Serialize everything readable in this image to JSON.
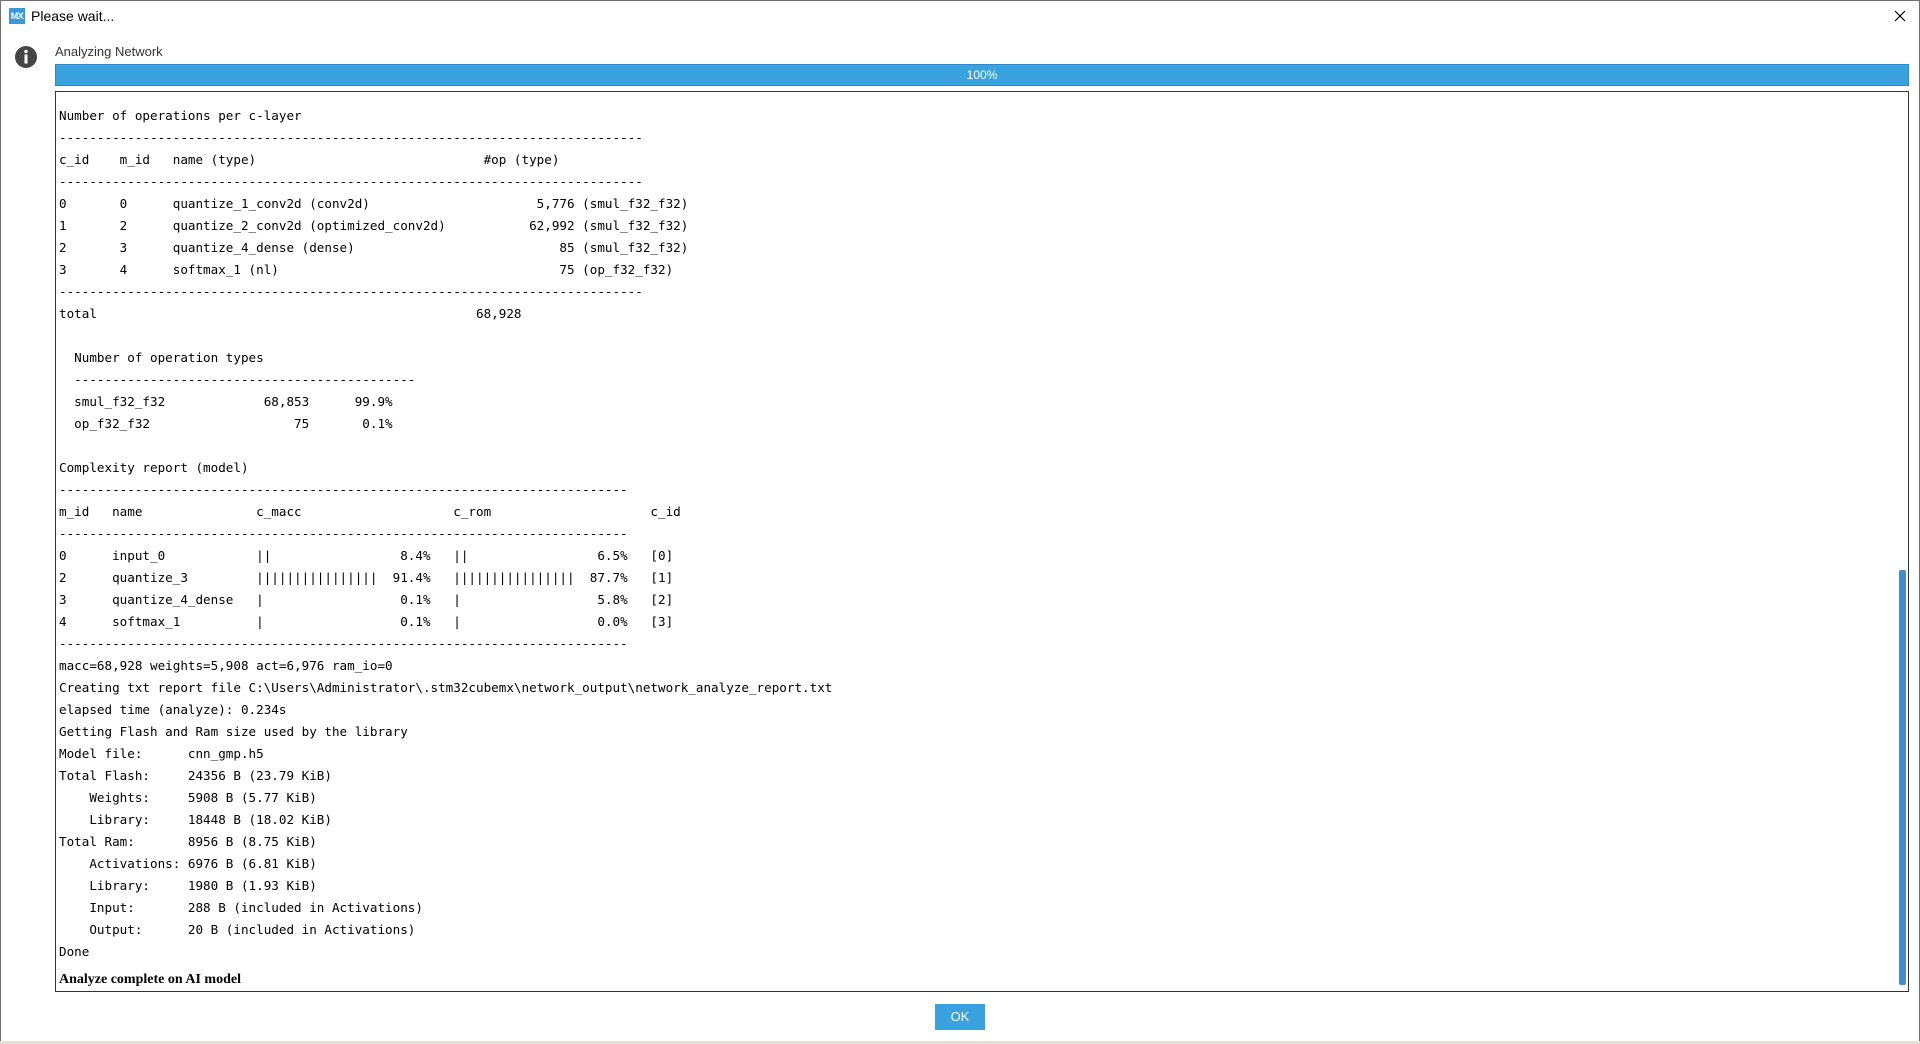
{
  "window": {
    "title": "Please wait...",
    "app_icon_label": "MX",
    "accent_color": "#3aa3df",
    "close_icon": "close-icon"
  },
  "status": {
    "label": "Analyzing Network",
    "info_icon": "info-icon",
    "progress_percent": 100,
    "progress_text": "100%"
  },
  "console": {
    "lines": [
      "Number of operations per c-layer",
      "-----------------------------------------------------------------------------",
      "c_id    m_id   name (type)                              #op (type)",
      "-----------------------------------------------------------------------------",
      "0       0      quantize_1_conv2d (conv2d)                      5,776 (smul_f32_f32)",
      "1       2      quantize_2_conv2d (optimized_conv2d)           62,992 (smul_f32_f32)",
      "2       3      quantize_4_dense (dense)                           85 (smul_f32_f32)",
      "3       4      softmax_1 (nl)                                     75 (op_f32_f32)",
      "-----------------------------------------------------------------------------",
      "total                                                  68,928",
      "",
      "  Number of operation types",
      "  ---------------------------------------------",
      "  smul_f32_f32             68,853      99.9%",
      "  op_f32_f32                   75       0.1%",
      "",
      "Complexity report (model)",
      "---------------------------------------------------------------------------",
      "m_id   name               c_macc                    c_rom                     c_id",
      "---------------------------------------------------------------------------",
      "0      input_0            ||                 8.4%   ||                 6.5%   [0]",
      "2      quantize_3         ||||||||||||||||  91.4%   ||||||||||||||||  87.7%   [1]",
      "3      quantize_4_dense   |                  0.1%   |                  5.8%   [2]",
      "4      softmax_1          |                  0.1%   |                  0.0%   [3]",
      "---------------------------------------------------------------------------",
      "macc=68,928 weights=5,908 act=6,976 ram_io=0",
      "Creating txt report file C:\\Users\\Administrator\\.stm32cubemx\\network_output\\network_analyze_report.txt",
      "elapsed time (analyze): 0.234s",
      "Getting Flash and Ram size used by the library",
      "Model file:      cnn_gmp.h5",
      "Total Flash:     24356 B (23.79 KiB)",
      "    Weights:     5908 B (5.77 KiB)",
      "    Library:     18448 B (18.02 KiB)",
      "Total Ram:       8956 B (8.75 KiB)",
      "    Activations: 6976 B (6.81 KiB)",
      "    Library:     1980 B (1.93 KiB)",
      "    Input:       288 B (included in Activations)",
      "    Output:      20 B (included in Activations)",
      "Done"
    ],
    "final_line": "Analyze complete on AI model"
  },
  "footer": {
    "ok_label": "OK"
  }
}
